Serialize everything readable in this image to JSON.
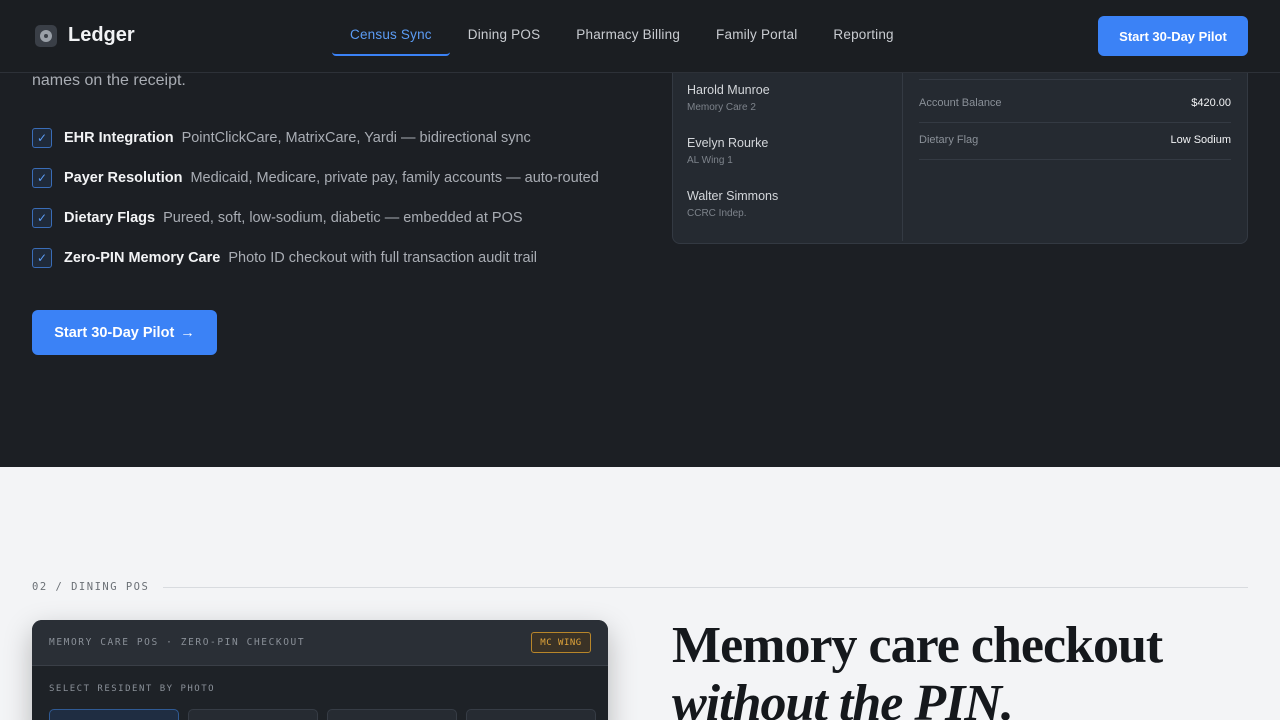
{
  "header": {
    "brand": "Ledger",
    "nav": [
      "Census Sync",
      "Dining POS",
      "Pharmacy Billing",
      "Family Portal",
      "Reporting"
    ],
    "active_nav": "Census Sync",
    "cta": "Start 30-Day Pilot"
  },
  "hero": {
    "lead_tail": "names on the receipt.",
    "features": [
      {
        "title": "EHR Integration",
        "desc": "PointClickCare, MatrixCare, Yardi — bidirectional sync"
      },
      {
        "title": "Payer Resolution",
        "desc": "Medicaid, Medicare, private pay, family accounts — auto-routed"
      },
      {
        "title": "Dietary Flags",
        "desc": "Pureed, soft, low-sodium, diabetic — embedded at POS"
      },
      {
        "title": "Zero-PIN Memory Care",
        "desc": "Photo ID checkout with full transaction audit trail"
      }
    ],
    "cta": "Start 30-Day Pilot",
    "cta_arrow": "→"
  },
  "census_panel": {
    "residents": [
      {
        "name": "Harold Munroe",
        "location": "Memory Care 2"
      },
      {
        "name": "Evelyn Rourke",
        "location": "AL Wing 1"
      },
      {
        "name": "Walter Simmons",
        "location": "CCRC Indep."
      }
    ],
    "details": [
      {
        "key": "Account Balance",
        "value": "$420.00"
      },
      {
        "key": "Dietary Flag",
        "value": "Low Sodium"
      }
    ]
  },
  "dining_section": {
    "label": "02 / DINING POS",
    "pos_title": "MEMORY CARE POS · ZERO-PIN CHECKOUT",
    "pos_badge": "MC WING",
    "pos_subtitle": "SELECT RESIDENT BY PHOTO",
    "headline_line1": "Memory care checkout",
    "headline_line2": "without the PIN."
  },
  "colors": {
    "accent": "#3b82f6",
    "dark_bg": "#1c1f24",
    "light_bg": "#f3f4f6",
    "badge": "#e0a43a"
  },
  "icons": {
    "brand": "shield-logo-icon",
    "feature_check": "checkmark-icon",
    "cta_arrow": "arrow-right-icon"
  }
}
